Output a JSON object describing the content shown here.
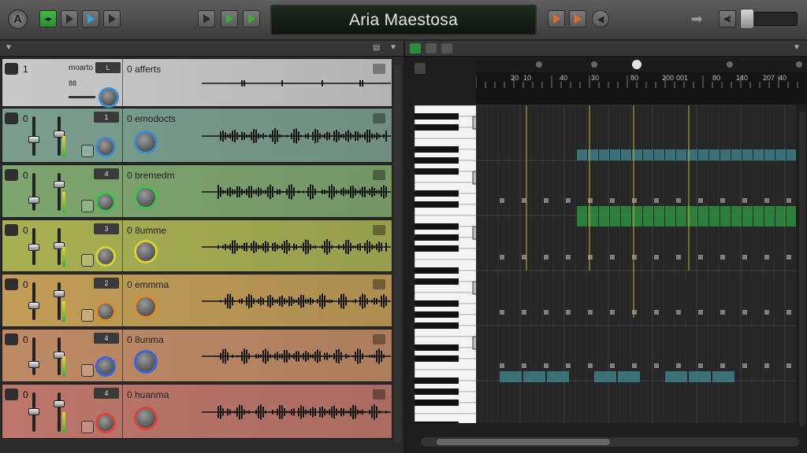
{
  "toolbar": {
    "logo_letter": "A",
    "project_title": "Aria Maestosa"
  },
  "tracks": [
    {
      "name": "0 afferts",
      "number": "1",
      "pill": "L",
      "tint": "#c9c9c9",
      "knob_color": "#3a8fd0",
      "labels": {
        "a": "moarto",
        "b": "88"
      }
    },
    {
      "name": "0 emodocts",
      "pill": "1",
      "tint": "#7a9e8d",
      "knob_color": "#3a8fd0"
    },
    {
      "name": "0 bremedm",
      "pill": "4",
      "tint": "#7ea66e",
      "knob_color": "#3cc24e"
    },
    {
      "name": "0 8umme",
      "pill": "3",
      "tint": "#a8b052",
      "knob_color": "#d8d23a"
    },
    {
      "name": "0 emmma",
      "pill": "2",
      "tint": "#c19d56",
      "knob_color": "#e08a2a"
    },
    {
      "name": "0 8unma",
      "pill": "4",
      "tint": "#bf8a66",
      "knob_color": "#3b66d4"
    },
    {
      "name": "0 huanma",
      "pill": "4",
      "tint": "#bd766a",
      "knob_color": "#d8463c"
    }
  ],
  "track_side_letters": [
    "0",
    "0",
    "0",
    "0",
    "0",
    "0"
  ],
  "ruler": {
    "labels": [
      "20",
      "10",
      "40",
      "30",
      "80",
      "200",
      "001",
      "80",
      "140",
      "207",
      "40"
    ]
  },
  "piano_roll": {
    "note_rows": [
      {
        "color": "#3d7f86",
        "bars": 26
      },
      {
        "color": "#2f8f3f",
        "bars": 26
      },
      {
        "color": "#5a5a5a",
        "bars": 0
      },
      {
        "color": "#3d7f86",
        "bars": 12
      }
    ]
  },
  "colors": {
    "accent_green": "#35b13a",
    "accent_blue": "#3aa0e0",
    "accent_orange": "#e06a28",
    "playhead": "#c9b23a"
  }
}
